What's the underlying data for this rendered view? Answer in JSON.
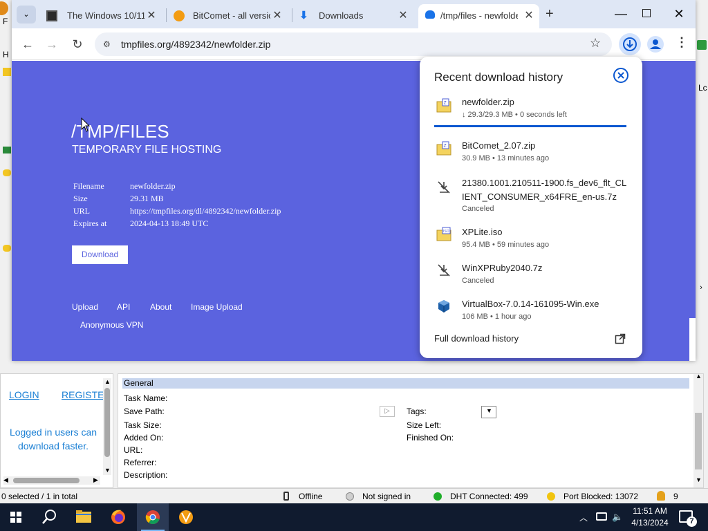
{
  "bitcomet": {
    "left_panel": {
      "login": "LOGIN",
      "register": "REGISTER",
      "message": "Logged in users can download faster."
    },
    "info": {
      "section": "General",
      "task_name": "Task Name:",
      "save_path": "Save Path:",
      "task_size": "Task Size:",
      "added_on": "Added On:",
      "url": "URL:",
      "referrer": "Referrer:",
      "description": "Description:",
      "tags": "Tags:",
      "size_left": "Size Left:",
      "finished_on": "Finished On:"
    },
    "status": {
      "selected": "0 selected / 1 in total",
      "offline": "Offline",
      "not_signed": "Not signed in",
      "dht": "DHT Connected: 499",
      "port": "Port Blocked: 13072",
      "notif_count": "9"
    }
  },
  "chrome": {
    "tabs": [
      {
        "title": "The Windows 10/11"
      },
      {
        "title": "BitComet - all versio"
      },
      {
        "title": "Downloads"
      },
      {
        "title": "/tmp/files - newfolde"
      }
    ],
    "url": "tmpfiles.org/4892342/newfolder.zip",
    "page": {
      "title": "/TMP/FILES",
      "subtitle": "TEMPORARY FILE HOSTING",
      "meta": [
        {
          "label": "Filename",
          "value": "newfolder.zip"
        },
        {
          "label": "Size",
          "value": "29.31 MB"
        },
        {
          "label": "URL",
          "value": "https://tmpfiles.org/dl/4892342/newfolder.zip"
        },
        {
          "label": "Expires at",
          "value": "2024-04-13 18:49 UTC"
        }
      ],
      "download_button": "Download",
      "footer_links": [
        "Upload",
        "API",
        "About",
        "Image Upload",
        "Anonymous VPN"
      ]
    },
    "downloads_popup": {
      "title": "Recent download history",
      "items": [
        {
          "name": "newfolder.zip",
          "status": "↓ 29.3/29.3 MB • 0 seconds left",
          "icon": "zip-file-icon",
          "progress": 1.0
        },
        {
          "name": "BitComet_2.07.zip",
          "status": "30.9 MB • 13 minutes ago",
          "icon": "zip-file-icon"
        },
        {
          "name": "21380.1001.210511-1900.fs_dev6_flt_CLIENT_CONSUMER_x64FRE_en-us.7z",
          "status": "Canceled",
          "icon": "canceled-download-icon"
        },
        {
          "name": "XPLite.iso",
          "status": "95.4 MB • 59 minutes ago",
          "icon": "iso-file-icon"
        },
        {
          "name": "WinXPRuby2040.7z",
          "status": "Canceled",
          "icon": "canceled-download-icon"
        },
        {
          "name": "VirtualBox-7.0.14-161095-Win.exe",
          "status": "106 MB • 1 hour ago",
          "icon": "virtualbox-icon"
        }
      ],
      "full_history": "Full download history"
    }
  },
  "taskbar": {
    "time": "11:51 AM",
    "date": "4/13/2024",
    "notification_count": "7"
  },
  "colors": {
    "page_bg": "#5b63df",
    "tab_strip": "#dfe7f5",
    "accent_blue": "#1a73e8",
    "taskbar": "#101b2f"
  }
}
